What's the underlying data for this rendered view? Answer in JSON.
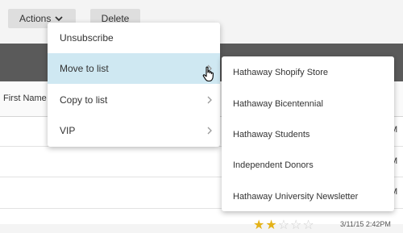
{
  "toolbar": {
    "actions_label": "Actions",
    "delete_label": "Delete"
  },
  "table": {
    "first_name_header": "First Name",
    "row_time_suffix": "M",
    "rating_stars": 2,
    "rating_max": 5,
    "bottom_timestamp": "3/11/15 2:42PM"
  },
  "actions_menu": {
    "items": [
      {
        "label": "Unsubscribe",
        "has_submenu": false
      },
      {
        "label": "Move to list",
        "has_submenu": true,
        "highlighted": true
      },
      {
        "label": "Copy to list",
        "has_submenu": true
      },
      {
        "label": "VIP",
        "has_submenu": true
      }
    ]
  },
  "list_submenu": {
    "items": [
      {
        "label": "Hathaway Shopify Store"
      },
      {
        "label": "Hathaway Bicentennial"
      },
      {
        "label": "Hathaway Students"
      },
      {
        "label": "Independent Donors"
      },
      {
        "label": "Hathaway University Newsletter"
      }
    ]
  },
  "colors": {
    "highlight": "#cfe8f2",
    "header_band": "#5a5a5a",
    "star_on": "#e4b218"
  },
  "icons": {
    "actions_chevron": "chevron-down-icon",
    "submenu_arrow": "chevron-right-icon",
    "cursor": "hand-pointer-icon",
    "rating": "star-icon"
  }
}
